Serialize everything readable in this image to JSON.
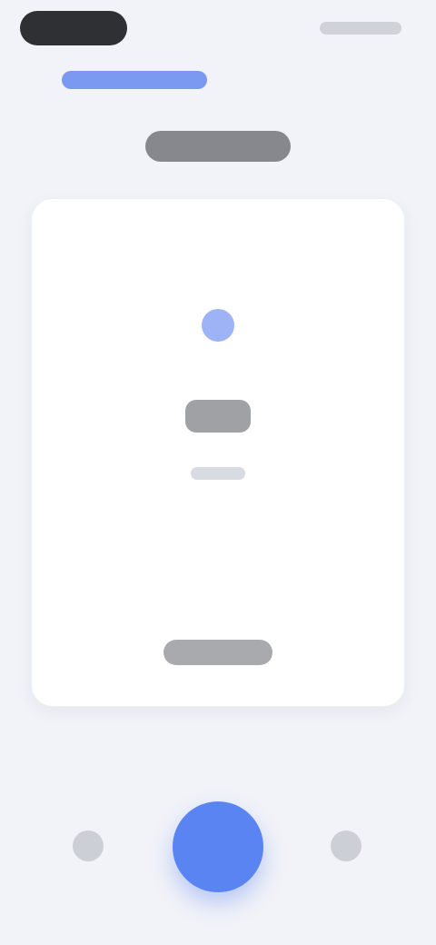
{
  "status_bar": {
    "left_pill": "",
    "right_indicators": ""
  },
  "header": {
    "back_label": "",
    "title": ""
  },
  "card": {
    "icon": "dot-icon",
    "value": "",
    "caption": "",
    "footer": ""
  },
  "controls": {
    "left_icon": "circle-icon",
    "center_icon": "primary-action-icon",
    "right_icon": "circle-icon"
  },
  "colors": {
    "accent": "#5b84f3",
    "background": "#f1f3f8",
    "card": "#ffffff"
  }
}
